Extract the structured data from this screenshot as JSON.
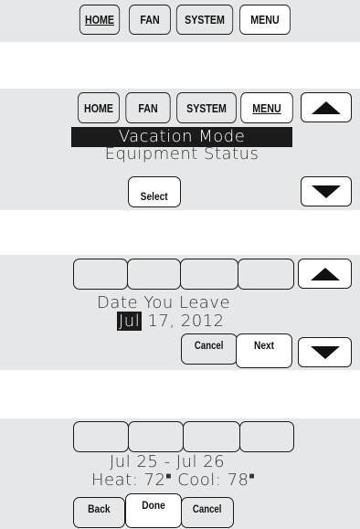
{
  "panel1": {
    "tabs": [
      "HOME",
      "FAN",
      "SYSTEM",
      "MENU"
    ]
  },
  "panel2": {
    "tabs": [
      "HOME",
      "FAN",
      "SYSTEM",
      "MENU"
    ],
    "menu_selected": "Vacation Mode",
    "menu_next": "Equipment Status",
    "select_label": "Select"
  },
  "panel3": {
    "title": "Date You Leave",
    "month": "Jul",
    "date_rest": " 17, 2012",
    "cancel_label": "Cancel",
    "next_label": "Next"
  },
  "panel4": {
    "date_range": "Jul 25 - Jul 26",
    "heat_label": "Heat:",
    "heat_value": "72",
    "cool_label": "Cool:",
    "cool_value": "78",
    "back_label": "Back",
    "done_label": "Done",
    "cancel_label": "Cancel"
  },
  "colors": {
    "panel": "#e6e7e8",
    "highlight": "#1b1b1b",
    "border": "#1a1a1a"
  },
  "icons": [
    "up-arrow-icon",
    "down-arrow-icon"
  ]
}
